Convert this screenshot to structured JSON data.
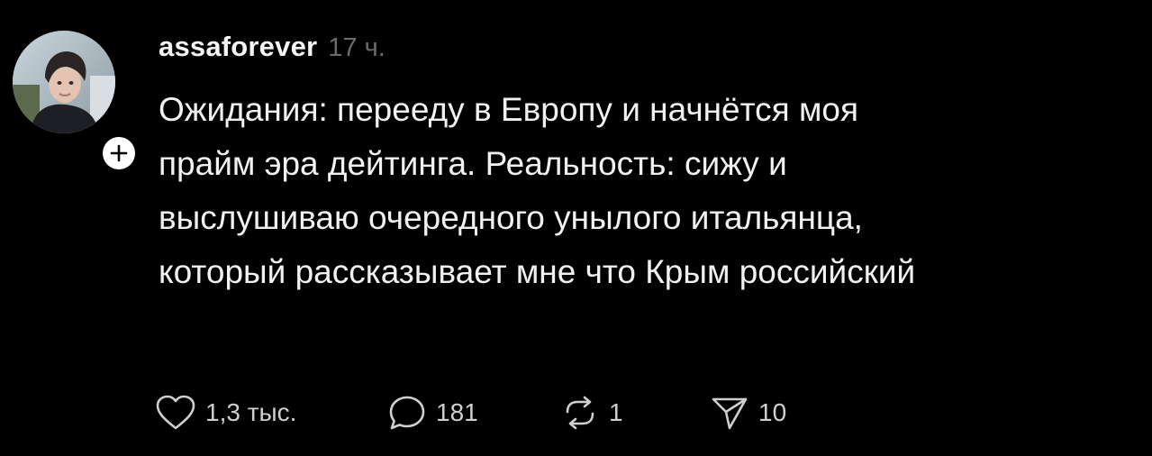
{
  "post": {
    "username": "assaforever",
    "time": "17 ч.",
    "text_lines": [
      "Ожидания: перееду в Европу и начнётся моя",
      "прайм эра дейтинга. Реальность: сижу и",
      "выслушиваю очередного унылого итальянца,",
      "который рассказывает мне что Крым российский"
    ],
    "actions": {
      "likes": "1,3 тыс.",
      "replies": "181",
      "reposts": "1",
      "shares": "10"
    },
    "icons": {
      "like": "heart-icon",
      "reply": "comment-bubble-icon",
      "repost": "repost-arrows-icon",
      "share": "send-icon",
      "follow": "plus-icon"
    }
  },
  "colors": {
    "background": "#000000",
    "text": "#f1f1f1",
    "muted": "#6b6b6b",
    "icon": "#cfcfcf"
  }
}
